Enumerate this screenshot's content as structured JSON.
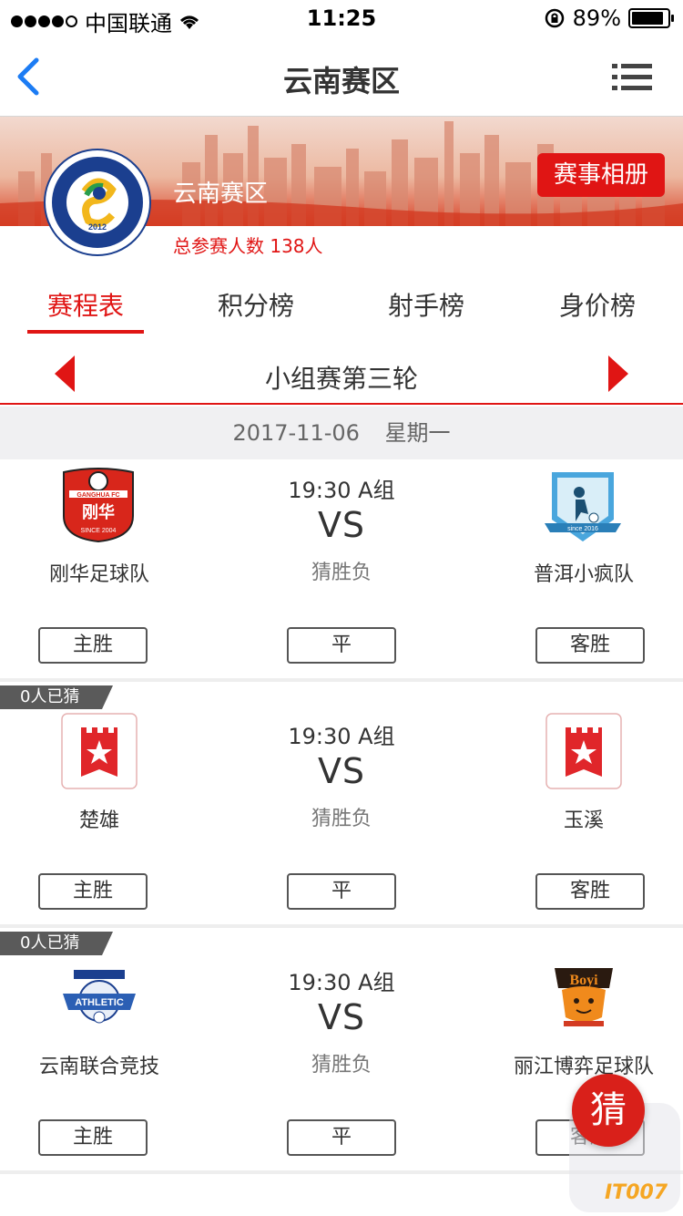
{
  "status_bar": {
    "carrier": "中国联通",
    "time": "11:25",
    "battery": "89%",
    "battery_level": 0.89
  },
  "nav": {
    "title": "云南赛区"
  },
  "banner": {
    "zone_name": "云南赛区",
    "album_label": "赛事相册",
    "participants": "总参赛人数 138人",
    "logo_text": "广东省五人足球协会 GUANGDONG FUTSAL ASSOCIATION 2012"
  },
  "tabs": [
    {
      "label": "赛程表",
      "active": true
    },
    {
      "label": "积分榜",
      "active": false
    },
    {
      "label": "射手榜",
      "active": false
    },
    {
      "label": "身价榜",
      "active": false
    }
  ],
  "round": {
    "title": "小组赛第三轮"
  },
  "date_bar": {
    "date": "2017-11-06",
    "weekday": "星期一"
  },
  "matches": [
    {
      "guess_count": "",
      "home": {
        "name": "刚华足球队",
        "logo_text": "GANGHUA FC 刚华 SINCE 2004"
      },
      "away": {
        "name": "普洱小疯队",
        "logo_text": "since 2016"
      },
      "time_group": "19:30 A组",
      "vs": "VS",
      "guess_label": "猜胜负",
      "buttons": {
        "home_win": "主胜",
        "draw": "平",
        "away_win": "客胜"
      }
    },
    {
      "guess_count": "0人已猜",
      "home": {
        "name": "楚雄",
        "logo_text": ""
      },
      "away": {
        "name": "玉溪",
        "logo_text": ""
      },
      "time_group": "19:30 A组",
      "vs": "VS",
      "guess_label": "猜胜负",
      "buttons": {
        "home_win": "主胜",
        "draw": "平",
        "away_win": "客胜"
      }
    },
    {
      "guess_count": "0人已猜",
      "home": {
        "name": "云南联合竞技",
        "logo_text": "ATHLETIC"
      },
      "away": {
        "name": "丽江博弈足球队",
        "logo_text": "Boyi"
      },
      "time_group": "19:30 A组",
      "vs": "VS",
      "guess_label": "猜胜负",
      "buttons": {
        "home_win": "主胜",
        "draw": "平",
        "away_win": "客胜"
      }
    }
  ],
  "floating": {
    "guess_button": "猜",
    "watermark": "IT007"
  },
  "colors": {
    "accent": "#e01514",
    "link_blue": "#1c7cf4",
    "tag_gray": "#5a5a5a"
  }
}
